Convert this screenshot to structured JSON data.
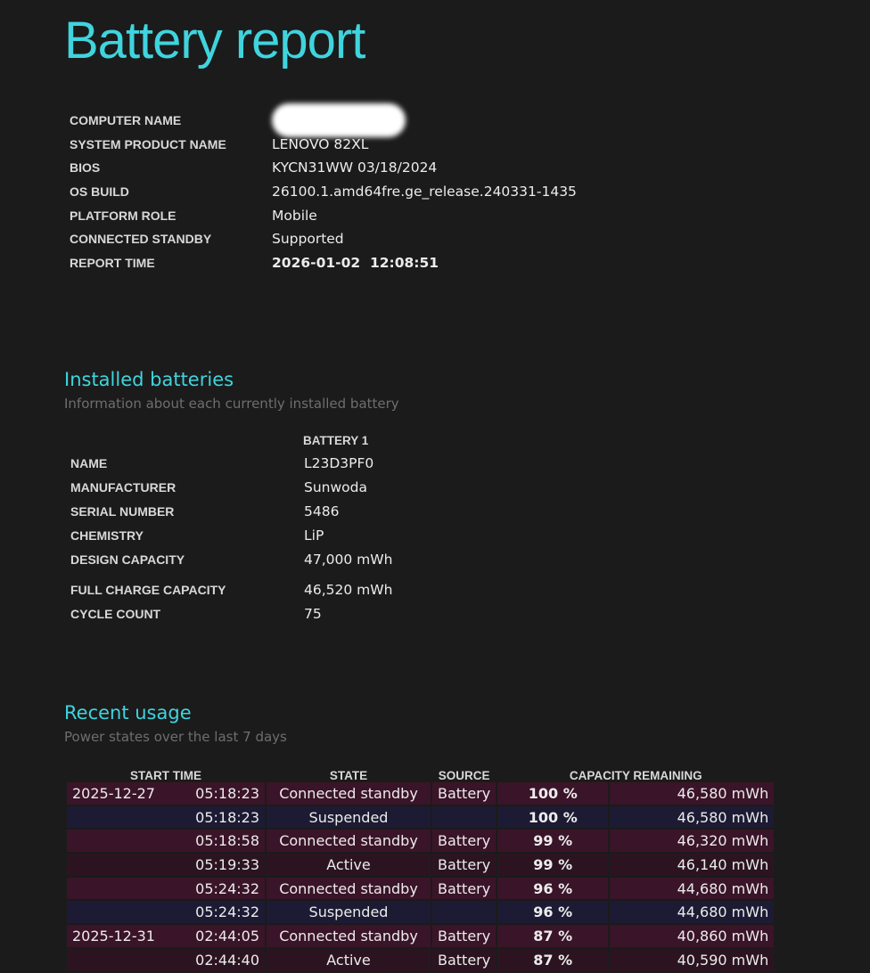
{
  "title": "Battery report",
  "system": {
    "rows": [
      {
        "key": "COMPUTER NAME",
        "value": ""
      },
      {
        "key": "SYSTEM PRODUCT NAME",
        "value": "LENOVO 82XL"
      },
      {
        "key": "BIOS",
        "value": "KYCN31WW 03/18/2024"
      },
      {
        "key": "OS BUILD",
        "value": "26100.1.amd64fre.ge_release.240331-1435"
      },
      {
        "key": "PLATFORM ROLE",
        "value": "Mobile"
      },
      {
        "key": "CONNECTED STANDBY",
        "value": "Supported"
      },
      {
        "key": "REPORT TIME",
        "value": "2026-01-02  12:08:51"
      }
    ]
  },
  "installed": {
    "heading": "Installed batteries",
    "subheading": "Information about each currently installed battery",
    "column": "BATTERY 1",
    "rows": [
      {
        "key": "NAME",
        "value": "L23D3PF0"
      },
      {
        "key": "MANUFACTURER",
        "value": "Sunwoda"
      },
      {
        "key": "SERIAL NUMBER",
        "value": "5486"
      },
      {
        "key": "CHEMISTRY",
        "value": "LiP"
      },
      {
        "key": "DESIGN CAPACITY",
        "value": "47,000 mWh"
      },
      {
        "key": "FULL CHARGE CAPACITY",
        "value": "46,520 mWh"
      },
      {
        "key": "CYCLE COUNT",
        "value": "75"
      }
    ]
  },
  "usage": {
    "heading": "Recent usage",
    "subheading": "Power states over the last 7 days",
    "headers": [
      "START TIME",
      "STATE",
      "SOURCE",
      "CAPACITY REMAINING"
    ],
    "rows": [
      {
        "date": "2025-12-27",
        "time": "05:18:23",
        "state": "Connected standby",
        "source": "Battery",
        "pct": "100 %",
        "cap": "46,580 mWh"
      },
      {
        "date": "",
        "time": "05:18:23",
        "state": "Suspended",
        "source": "",
        "pct": "100 %",
        "cap": "46,580 mWh"
      },
      {
        "date": "",
        "time": "05:18:58",
        "state": "Connected standby",
        "source": "Battery",
        "pct": "99 %",
        "cap": "46,320 mWh"
      },
      {
        "date": "",
        "time": "05:19:33",
        "state": "Active",
        "source": "Battery",
        "pct": "99 %",
        "cap": "46,140 mWh"
      },
      {
        "date": "",
        "time": "05:24:32",
        "state": "Connected standby",
        "source": "Battery",
        "pct": "96 %",
        "cap": "44,680 mWh"
      },
      {
        "date": "",
        "time": "05:24:32",
        "state": "Suspended",
        "source": "",
        "pct": "96 %",
        "cap": "44,680 mWh"
      },
      {
        "date": "2025-12-31",
        "time": "02:44:05",
        "state": "Connected standby",
        "source": "Battery",
        "pct": "87 %",
        "cap": "40,860 mWh"
      },
      {
        "date": "",
        "time": "02:44:40",
        "state": "Active",
        "source": "Battery",
        "pct": "87 %",
        "cap": "40,590 mWh"
      }
    ]
  }
}
